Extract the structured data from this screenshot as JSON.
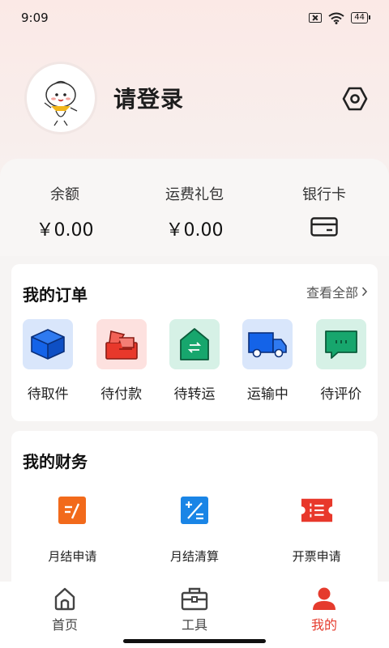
{
  "status_bar": {
    "time": "9:09",
    "battery": "44"
  },
  "profile": {
    "login_text": "请登录"
  },
  "wallet": {
    "items": [
      {
        "label": "余额",
        "value": "￥0.00"
      },
      {
        "label": "运费礼包",
        "value": "￥0.00"
      },
      {
        "label": "银行卡",
        "icon": "bank-card-icon"
      }
    ]
  },
  "orders": {
    "title": "我的订单",
    "view_all": "查看全部",
    "items": [
      {
        "label": "待取件",
        "icon": "package-box-icon",
        "bg": "#d9e6fb",
        "color": "#1463e8"
      },
      {
        "label": "待付款",
        "icon": "payment-card-icon",
        "bg": "#fde1df",
        "color": "#e8382b"
      },
      {
        "label": "待转运",
        "icon": "transfer-house-icon",
        "bg": "#d6f1e6",
        "color": "#17a66d"
      },
      {
        "label": "运输中",
        "icon": "truck-icon",
        "bg": "#d9e6fb",
        "color": "#1463e8"
      },
      {
        "label": "待评价",
        "icon": "comment-bubble-icon",
        "bg": "#d6f1e6",
        "color": "#17a66d"
      }
    ]
  },
  "finance": {
    "title": "我的财务",
    "items": [
      {
        "label": "月结申请",
        "icon": "monthly-apply-icon",
        "color": "#f26a1b"
      },
      {
        "label": "月结清算",
        "icon": "calculator-icon",
        "color": "#1a85e6"
      },
      {
        "label": "开票申请",
        "icon": "invoice-ticket-icon",
        "color": "#e8382b"
      }
    ]
  },
  "tabbar": {
    "items": [
      {
        "label": "首页",
        "icon": "home-icon"
      },
      {
        "label": "工具",
        "icon": "toolbox-icon"
      },
      {
        "label": "我的",
        "icon": "user-icon",
        "active": true
      }
    ],
    "accent": "#e53b2d"
  }
}
